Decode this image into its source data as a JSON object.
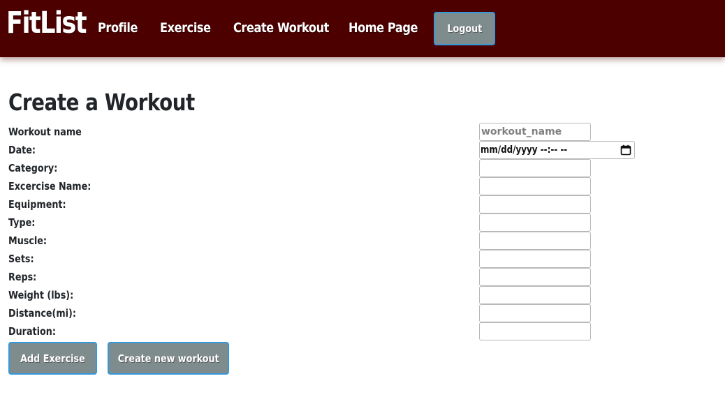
{
  "nav": {
    "brand": "FitList",
    "links": [
      "Profile",
      "Exercise",
      "Create Workout",
      "Home Page"
    ],
    "logout_label": "Logout",
    "colors": {
      "bar": "#4d0000",
      "button": "#7f8c8d",
      "button_border": "#3498db"
    }
  },
  "page": {
    "title": "Create a Workout"
  },
  "form": {
    "labels": {
      "workout_name": "Workout name",
      "date": "Date:",
      "category": "Category:",
      "exercise_name": "Excercise Name:",
      "equipment": "Equipment:",
      "type": "Type:",
      "muscle": "Muscle:",
      "sets": "Sets:",
      "reps": "Reps:",
      "weight": "Weight (lbs):",
      "distance": "Distance(mi):",
      "duration": "Duration:"
    },
    "workout_name_placeholder": "workout_name",
    "date_placeholder": "mm/dd/yyyy --:-- --",
    "values": {
      "category": "",
      "exercise_name": "",
      "equipment": "",
      "type": "",
      "muscle": "",
      "sets": "",
      "reps": "",
      "weight": "",
      "distance": "",
      "duration": ""
    }
  },
  "actions": {
    "add_exercise": "Add Exercise",
    "create_new_workout": "Create new workout"
  },
  "icons": {
    "date_picker": "calendar-icon"
  }
}
